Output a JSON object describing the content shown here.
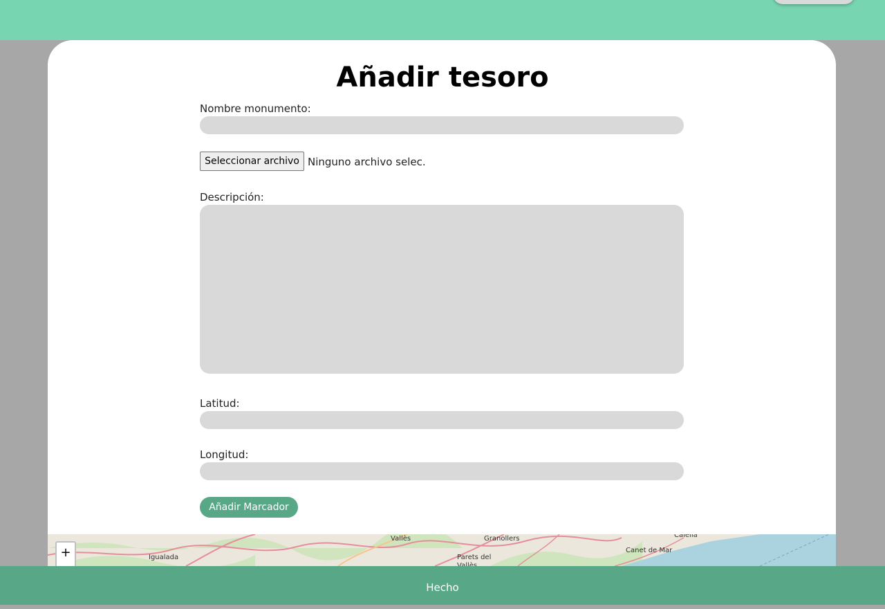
{
  "header": {
    "menu_label": ""
  },
  "form": {
    "title": "Añadir tesoro",
    "name_label": "Nombre monumento:",
    "name_value": "",
    "file_button": "Seleccionar archivo",
    "file_status": "Ninguno archivo selec.",
    "description_label": "Descripción:",
    "description_value": "",
    "latitude_label": "Latitud:",
    "latitude_value": "",
    "longitude_label": "Longitud:",
    "longitude_value": "",
    "add_marker_button": "Añadir Marcador"
  },
  "map": {
    "zoom_in": "+",
    "places": [
      "Vallès",
      "Granollers",
      "Calella",
      "Igualada",
      "Parets del Vallès",
      "Canet de Mar"
    ],
    "sea_color": "#aad3df",
    "land_color": "#ece7dc"
  },
  "footer": {
    "done_label": "Hecho"
  },
  "colors": {
    "topbar": "#78d5b1",
    "accent": "#58a888",
    "background": "#a6a7a6",
    "field": "#d9d9d9"
  }
}
